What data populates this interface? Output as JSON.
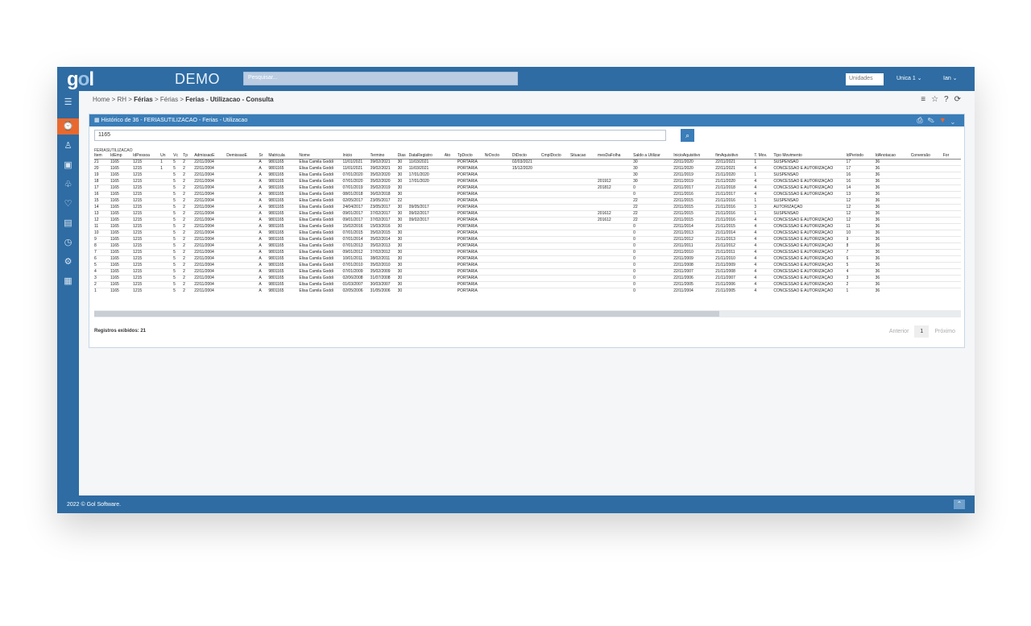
{
  "app": {
    "logo": "gol",
    "title": "DEMO",
    "search_placeholder": "Pesquisar...",
    "units_label": "Unidades",
    "unit_value": "Unica 1 ⌄",
    "user": "Ian ⌄"
  },
  "breadcrumb": {
    "home": "Home",
    "sep1": " > ",
    "rh": "RH",
    "sep2": " > ",
    "ferias": "Férias",
    "sep3": " > ",
    "ferias2": "Férias",
    "sep4": " > ",
    "page": "Ferias - Utilizacao - Consulta"
  },
  "page_actions": {
    "settings_icon": "≡",
    "star_icon": "☆",
    "help_icon": "?",
    "refresh_icon": "⟳"
  },
  "panel": {
    "title": "Histórico de 36 - FERIASUTILIZACAO - Ferias - Utilizacao",
    "filter_value": "1165",
    "table_name": "FERIASUTILIZACAO",
    "records": "Registros exibidos: 21",
    "pager": {
      "previous": "Anterior",
      "current": "1",
      "next": "Próximo"
    }
  },
  "columns": [
    "Item",
    "IdEmp",
    "IdPessoa",
    "Un",
    "Vc",
    "Tp",
    "AdmissaoE",
    "DemissaoE",
    "Sr",
    "Matricula",
    "Nome",
    "Inicio",
    "Termino",
    "Dias",
    "DataRegistro",
    "Ato",
    "TpDocto",
    "NrDocto",
    "DtDocto",
    "CmplDocto",
    "Situacao",
    "mesDaFolha",
    "Saldo a Utilizar",
    "InicioAquisitivo",
    "fimAquisitivo",
    "T. Mov.",
    "Tipo Movimento",
    "IdPeriodo",
    "IdAnotacao",
    "Conversão",
    "For"
  ],
  "rows": [
    [
      "21",
      "1165",
      "1215",
      "1",
      "5",
      "2",
      "22/11/2004",
      "",
      "A",
      "9801165",
      "Elisa Camila Goddi",
      "11/01/2021",
      "09/02/2021",
      "30",
      "11/03/2021",
      "",
      "PORTARIA",
      "",
      "02/03/2021",
      "",
      "",
      "",
      "30",
      "22/11/2020",
      "22/11/2021",
      "1",
      "SUSPENSÃO",
      "17",
      "36",
      "",
      ""
    ],
    [
      "20",
      "1165",
      "1215",
      "1",
      "5",
      "2",
      "22/11/2004",
      "",
      "A",
      "9801165",
      "Elisa Camila Goddi",
      "11/01/2021",
      "09/02/2021",
      "30",
      "11/03/2021",
      "",
      "PORTARIA",
      "",
      "15/12/2020",
      "",
      "",
      "",
      "30",
      "22/11/2020",
      "22/11/2021",
      "4",
      "CONCESSÃO E AUTORIZAÇÃO",
      "17",
      "36",
      "",
      ""
    ],
    [
      "19",
      "1165",
      "1215",
      "",
      "5",
      "2",
      "22/11/2004",
      "",
      "A",
      "9801165",
      "Elisa Camila Goddi",
      "07/01/2020",
      "05/02/2020",
      "30",
      "17/01/2020",
      "",
      "PORTARIA",
      "",
      "",
      "",
      "",
      "",
      "30",
      "22/11/2019",
      "21/11/2020",
      "1",
      "SUSPENSÃO",
      "16",
      "36",
      "",
      ""
    ],
    [
      "18",
      "1165",
      "1215",
      "",
      "5",
      "2",
      "22/11/2004",
      "",
      "A",
      "9801165",
      "Elisa Camila Goddi",
      "07/01/2020",
      "05/02/2020",
      "30",
      "17/01/2020",
      "",
      "PORTARIA",
      "",
      "",
      "",
      "",
      "201912",
      "30",
      "22/11/2019",
      "21/11/2020",
      "4",
      "CONCESSÃO E AUTORIZAÇÃO",
      "16",
      "36",
      "",
      ""
    ],
    [
      "17",
      "1165",
      "1215",
      "",
      "5",
      "2",
      "22/11/2004",
      "",
      "A",
      "9801165",
      "Elisa Camila Goddi",
      "07/01/2019",
      "05/02/2019",
      "30",
      "",
      "",
      "PORTARIA",
      "",
      "",
      "",
      "",
      "201812",
      "0",
      "22/11/2017",
      "21/11/2018",
      "4",
      "CONCESSÃO E AUTORIZAÇÃO",
      "14",
      "36",
      "",
      ""
    ],
    [
      "16",
      "1165",
      "1215",
      "",
      "5",
      "2",
      "22/11/2004",
      "",
      "A",
      "9801165",
      "Elisa Camila Goddi",
      "08/01/2018",
      "06/02/2018",
      "30",
      "",
      "",
      "PORTARIA",
      "",
      "",
      "",
      "",
      "",
      "0",
      "22/11/2016",
      "21/11/2017",
      "4",
      "CONCESSÃO E AUTORIZAÇÃO",
      "13",
      "36",
      "",
      ""
    ],
    [
      "15",
      "1165",
      "1215",
      "",
      "5",
      "2",
      "22/11/2004",
      "",
      "A",
      "9801165",
      "Elisa Camila Goddi",
      "02/05/2017",
      "23/05/2017",
      "22",
      "",
      "",
      "PORTARIA",
      "",
      "",
      "",
      "",
      "",
      "22",
      "22/11/2015",
      "21/11/2016",
      "1",
      "SUSPENSÃO",
      "12",
      "36",
      "",
      ""
    ],
    [
      "14",
      "1165",
      "1215",
      "",
      "5",
      "2",
      "22/11/2004",
      "",
      "A",
      "9801165",
      "Elisa Camila Goddi",
      "24/04/2017",
      "23/05/2017",
      "30",
      "09/05/2017",
      "",
      "PORTARIA",
      "",
      "",
      "",
      "",
      "",
      "22",
      "22/11/2015",
      "21/11/2016",
      "3",
      "AUTORIZAÇÃO",
      "12",
      "36",
      "",
      ""
    ],
    [
      "13",
      "1165",
      "1215",
      "",
      "5",
      "2",
      "22/11/2004",
      "",
      "A",
      "9801165",
      "Elisa Camila Goddi",
      "09/01/2017",
      "07/02/2017",
      "30",
      "09/02/2017",
      "",
      "PORTARIA",
      "",
      "",
      "",
      "",
      "201612",
      "22",
      "22/11/2015",
      "21/11/2016",
      "1",
      "SUSPENSÃO",
      "12",
      "36",
      "",
      ""
    ],
    [
      "12",
      "1165",
      "1215",
      "",
      "5",
      "2",
      "22/11/2004",
      "",
      "A",
      "9801165",
      "Elisa Camila Goddi",
      "09/01/2017",
      "07/02/2017",
      "30",
      "09/02/2017",
      "",
      "PORTARIA",
      "",
      "",
      "",
      "",
      "201612",
      "22",
      "22/11/2015",
      "21/11/2016",
      "4",
      "CONCESSÃO E AUTORIZAÇÃO",
      "12",
      "36",
      "",
      ""
    ],
    [
      "11",
      "1165",
      "1215",
      "",
      "5",
      "2",
      "22/11/2004",
      "",
      "A",
      "9801165",
      "Elisa Camila Goddi",
      "15/02/2016",
      "15/03/2016",
      "30",
      "",
      "",
      "PORTARIA",
      "",
      "",
      "",
      "",
      "",
      "0",
      "22/11/2014",
      "21/11/2015",
      "4",
      "CONCESSÃO E AUTORIZAÇÃO",
      "11",
      "36",
      "",
      ""
    ],
    [
      "10",
      "1165",
      "1215",
      "",
      "5",
      "2",
      "22/11/2004",
      "",
      "A",
      "9801165",
      "Elisa Camila Goddi",
      "07/01/2015",
      "05/02/2015",
      "30",
      "",
      "",
      "PORTARIA",
      "",
      "",
      "",
      "",
      "",
      "0",
      "22/11/2013",
      "21/11/2014",
      "4",
      "CONCESSÃO E AUTORIZAÇÃO",
      "10",
      "36",
      "",
      ""
    ],
    [
      "9",
      "1165",
      "1215",
      "",
      "5",
      "2",
      "22/11/2004",
      "",
      "A",
      "9801165",
      "Elisa Camila Goddi",
      "07/01/2014",
      "05/02/2014",
      "30",
      "",
      "",
      "PORTARIA",
      "",
      "",
      "",
      "",
      "",
      "0",
      "22/11/2012",
      "21/11/2013",
      "4",
      "CONCESSÃO E AUTORIZAÇÃO",
      "9",
      "36",
      "",
      ""
    ],
    [
      "8",
      "1165",
      "1215",
      "",
      "5",
      "2",
      "22/11/2004",
      "",
      "A",
      "9801165",
      "Elisa Camila Goddi",
      "07/01/2013",
      "05/02/2013",
      "30",
      "",
      "",
      "PORTARIA",
      "",
      "",
      "",
      "",
      "",
      "0",
      "22/11/2011",
      "21/11/2012",
      "4",
      "CONCESSÃO E AUTORIZAÇÃO",
      "8",
      "36",
      "",
      ""
    ],
    [
      "7",
      "1165",
      "1215",
      "",
      "5",
      "2",
      "22/11/2004",
      "",
      "A",
      "9801165",
      "Elisa Camila Goddi",
      "09/01/2012",
      "07/02/2012",
      "30",
      "",
      "",
      "PORTARIA",
      "",
      "",
      "",
      "",
      "",
      "0",
      "22/11/2010",
      "21/11/2011",
      "4",
      "CONCESSÃO E AUTORIZAÇÃO",
      "7",
      "36",
      "",
      ""
    ],
    [
      "6",
      "1165",
      "1215",
      "",
      "5",
      "2",
      "22/11/2004",
      "",
      "A",
      "9801165",
      "Elisa Camila Goddi",
      "10/01/2011",
      "08/02/2011",
      "30",
      "",
      "",
      "PORTARIA",
      "",
      "",
      "",
      "",
      "",
      "0",
      "22/11/2009",
      "21/11/2010",
      "4",
      "CONCESSÃO E AUTORIZAÇÃO",
      "6",
      "36",
      "",
      ""
    ],
    [
      "5",
      "1165",
      "1215",
      "",
      "5",
      "2",
      "22/11/2004",
      "",
      "A",
      "9801165",
      "Elisa Camila Goddi",
      "07/01/2010",
      "05/02/2010",
      "30",
      "",
      "",
      "PORTARIA",
      "",
      "",
      "",
      "",
      "",
      "0",
      "22/11/2008",
      "21/11/2009",
      "4",
      "CONCESSÃO E AUTORIZAÇÃO",
      "5",
      "36",
      "",
      ""
    ],
    [
      "4",
      "1165",
      "1215",
      "",
      "5",
      "2",
      "22/11/2004",
      "",
      "A",
      "9801165",
      "Elisa Camila Goddi",
      "07/01/2009",
      "05/02/2009",
      "30",
      "",
      "",
      "PORTARIA",
      "",
      "",
      "",
      "",
      "",
      "0",
      "22/11/2007",
      "21/11/2008",
      "4",
      "CONCESSÃO E AUTORIZAÇÃO",
      "4",
      "36",
      "",
      ""
    ],
    [
      "3",
      "1165",
      "1215",
      "",
      "5",
      "2",
      "22/11/2004",
      "",
      "A",
      "9801165",
      "Elisa Camila Goddi",
      "02/06/2008",
      "01/07/2008",
      "30",
      "",
      "",
      "PORTARIA",
      "",
      "",
      "",
      "",
      "",
      "0",
      "22/11/2006",
      "21/11/2007",
      "4",
      "CONCESSÃO E AUTORIZAÇÃO",
      "3",
      "36",
      "",
      ""
    ],
    [
      "2",
      "1165",
      "1215",
      "",
      "5",
      "2",
      "22/11/2004",
      "",
      "A",
      "9801165",
      "Elisa Camila Goddi",
      "01/03/2007",
      "30/03/2007",
      "30",
      "",
      "",
      "PORTARIA",
      "",
      "",
      "",
      "",
      "",
      "0",
      "22/11/2005",
      "21/11/2006",
      "4",
      "CONCESSÃO E AUTORIZAÇÃO",
      "2",
      "36",
      "",
      ""
    ],
    [
      "1",
      "1165",
      "1215",
      "",
      "5",
      "2",
      "22/11/2004",
      "",
      "A",
      "9801165",
      "Elisa Camila Goddi",
      "02/05/2006",
      "31/05/2006",
      "30",
      "",
      "",
      "PORTARIA",
      "",
      "",
      "",
      "",
      "",
      "0",
      "22/11/2004",
      "21/11/2005",
      "4",
      "CONCESSÃO E AUTORIZAÇÃO",
      "1",
      "36",
      "",
      ""
    ]
  ],
  "footer": {
    "copyright": "2022 © Gol Software.",
    "top_icon": "⌃"
  }
}
